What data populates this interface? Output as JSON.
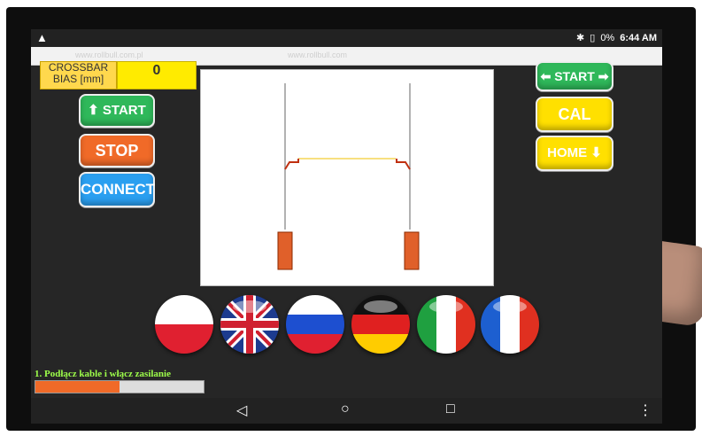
{
  "status_bar": {
    "warning_icon": "warning-triangle-icon",
    "bluetooth_icon": "bluetooth-icon",
    "battery_icon": "battery-icon",
    "battery_text": "0%",
    "time": "6:44 AM"
  },
  "url_strip": {
    "left_text": "www.rollbull.com.pl",
    "center_text": "www.rollbull.com"
  },
  "bias": {
    "label": "CROSSBAR BIAS [mm]",
    "value": "0"
  },
  "buttons": {
    "start_down": "START",
    "stop": "STOP",
    "connect": "CONNECT",
    "start_lr": "START",
    "cal": "CAL",
    "home": "HOME"
  },
  "flags": [
    {
      "name": "poland-flag"
    },
    {
      "name": "uk-flag"
    },
    {
      "name": "russia-flag"
    },
    {
      "name": "germany-flag"
    },
    {
      "name": "italy-flag"
    },
    {
      "name": "france-flag"
    }
  ],
  "instruction": "1. Podłącz kable i włącz zasilanie",
  "progress": 0.5,
  "nav": {
    "back": "◁",
    "home": "○",
    "recents": "□",
    "menu": "⋮"
  },
  "colors": {
    "green": "#2fb85a",
    "orange": "#f06a28",
    "blue": "#2a9ff0",
    "yellow": "#ffe000",
    "instruction": "#9eff4a"
  }
}
